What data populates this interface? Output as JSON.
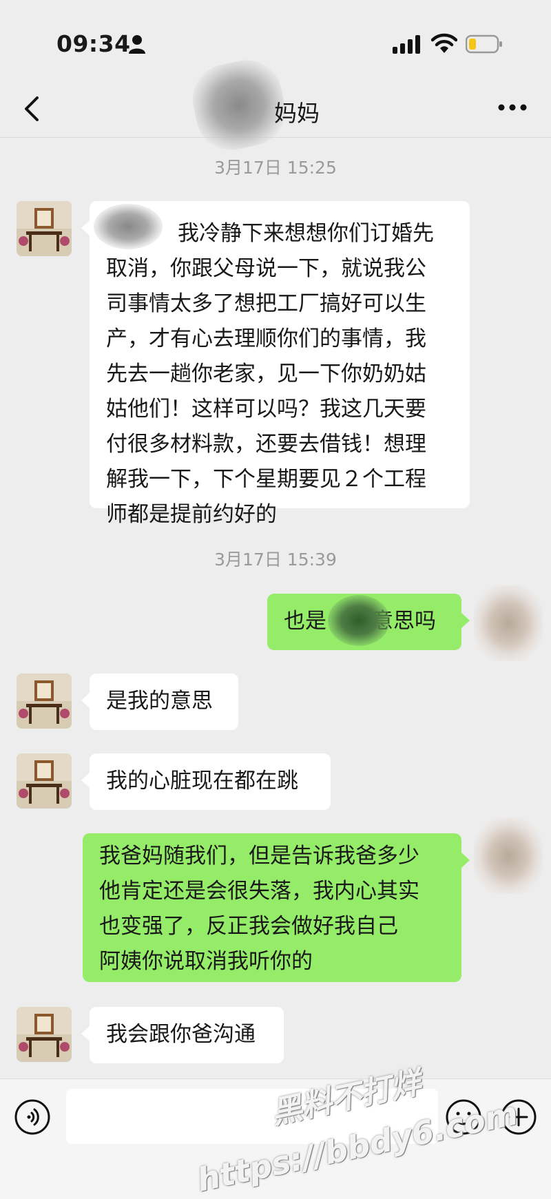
{
  "status_bar": {
    "time": "09:34"
  },
  "header": {
    "title": "妈妈"
  },
  "messages": {
    "ts1": "3月17日 15:25",
    "m1": [
      "我冷静下来想想你们订婚先",
      "取消，你跟父母说一下，就说我公",
      "司事情太多了想把工厂搞好可以生",
      "产，才有心去理顺你们的事情，我",
      "先去一趟你老家，见一下你奶奶姑",
      "姑他们！这样可以吗？我这几天要",
      "付很多材料款，还要去借钱！想理",
      "解我一下，下个星期要见２个工程",
      "师都是提前约好的"
    ],
    "ts2": "3月17日 15:39",
    "m2_prefix": "也是",
    "m2_suffix": "意思吗",
    "m3": "是我的意思",
    "m4": "我的心脏现在都在跳",
    "m5": [
      "我爸妈随我们，但是告诉我爸多少",
      "他肯定还是会很失落，我内心其实",
      "也变强了，反正我会做好我自己",
      "阿姨你说取消我听你的"
    ],
    "m6": "我会跟你爸沟通"
  },
  "watermark": {
    "line1": "黑料不打烊",
    "line2": "https://bbdy6.com"
  },
  "colors": {
    "background": "#ededed",
    "incoming_bubble": "#ffffff",
    "outgoing_bubble": "#95ec69"
  }
}
